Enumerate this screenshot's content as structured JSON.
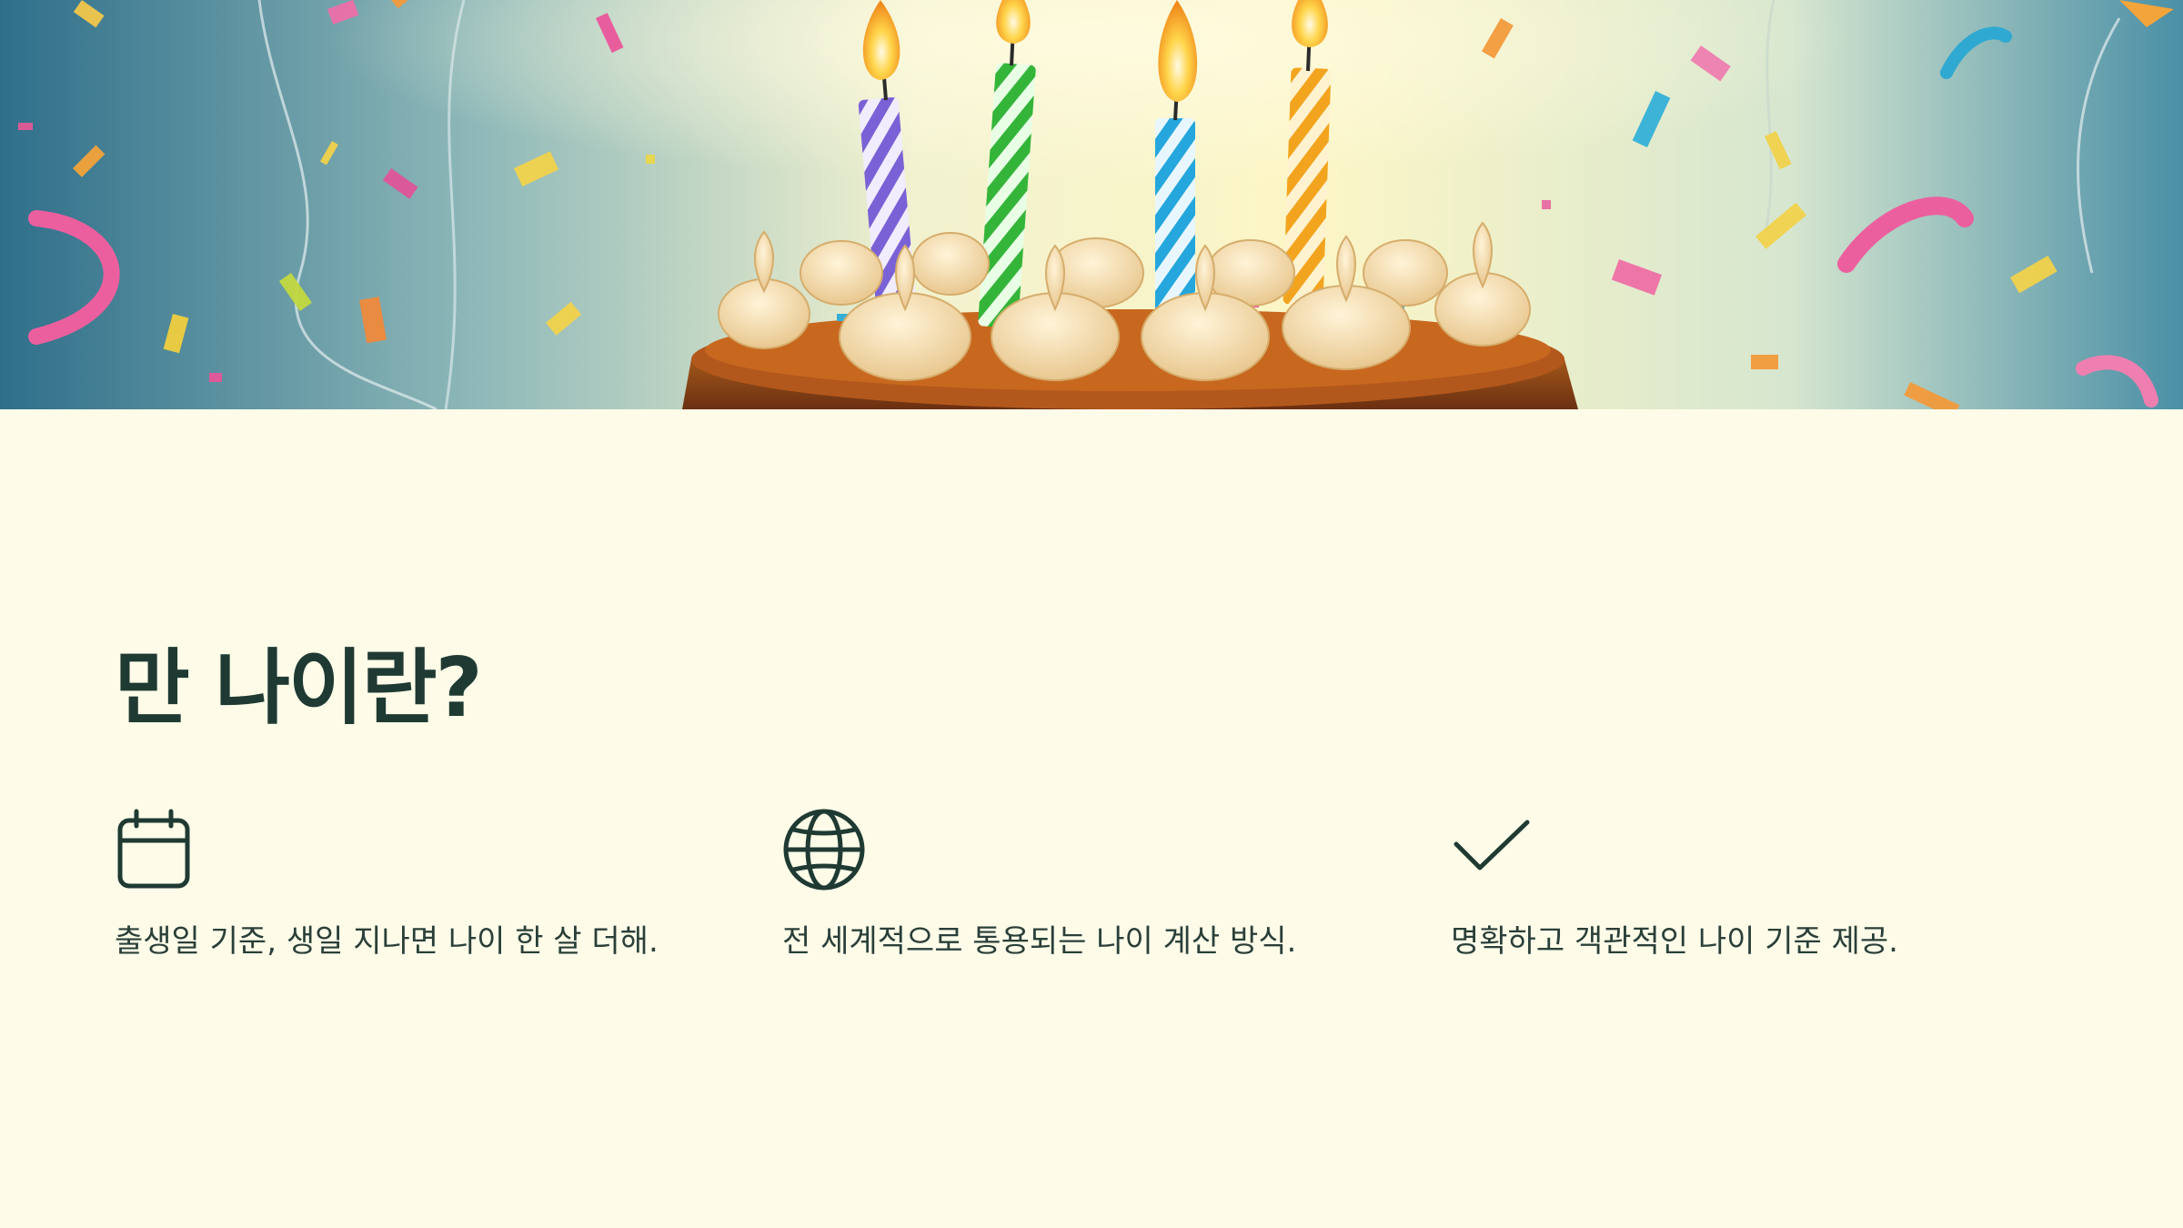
{
  "title": "만 나이란?",
  "colors": {
    "background": "#fefce9",
    "heading": "#1f3a33",
    "icon_stroke": "#1f3a33",
    "body_text": "#2a3f39"
  },
  "banner": {
    "image_subject": "birthday-cake-with-four-candles-and-confetti"
  },
  "features": [
    {
      "icon": "calendar-icon",
      "text": "출생일 기준, 생일 지나면 나이 한 살 더해."
    },
    {
      "icon": "globe-icon",
      "text": "전 세계적으로 통용되는 나이 계산 방식."
    },
    {
      "icon": "checkmark-icon",
      "text": "명확하고 객관적인 나이 기준 제공."
    }
  ]
}
